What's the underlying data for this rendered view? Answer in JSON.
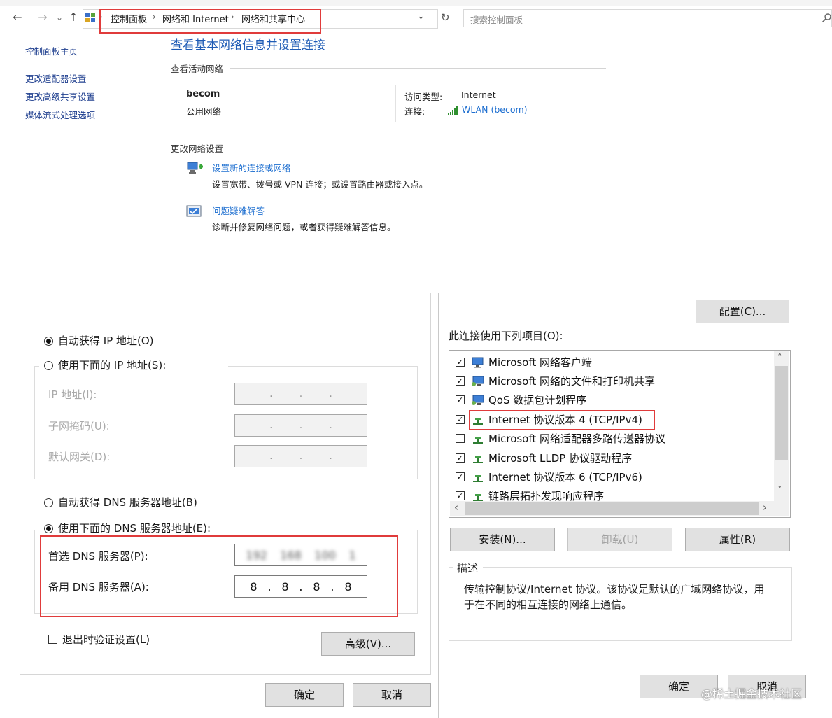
{
  "explorer": {
    "nav": {
      "back_icon": "←",
      "forward_icon": "→",
      "recent_icon": "⌄",
      "up_icon": "↑"
    },
    "breadcrumb": [
      "控制面板",
      "网络和 Internet",
      "网络和共享中心"
    ],
    "breadcrumb_sep": "›",
    "dropdown_icon": "⌄",
    "refresh_icon": "↻",
    "search_placeholder": "搜索控制面板"
  },
  "sidebar": {
    "home": "控制面板主页",
    "links": [
      "更改适配器设置",
      "更改高级共享设置",
      "媒体流式处理选项"
    ]
  },
  "main": {
    "title": "查看基本网络信息并设置连接",
    "active_networks_label": "查看活动网络",
    "network_name": "becom",
    "network_type": "公用网络",
    "access_type_label": "访问类型:",
    "access_type_value": "Internet",
    "connection_label": "连接:",
    "connection_value": "WLAN (becom)",
    "change_settings_label": "更改网络设置",
    "tasks": [
      {
        "title": "设置新的连接或网络",
        "desc": "设置宽带、拨号或 VPN 连接；或设置路由器或接入点。"
      },
      {
        "title": "问题疑难解答",
        "desc": "诊断并修复网络问题，或者获得疑难解答信息。"
      }
    ]
  },
  "ipv4_dialog": {
    "auto_ip": "自动获得 IP 地址(O)",
    "manual_ip": "使用下面的 IP 地址(S):",
    "ip_label": "IP 地址(I):",
    "mask_label": "子网掩码(U):",
    "gateway_label": "默认网关(D):",
    "ip_dot": ".",
    "auto_dns": "自动获得 DNS 服务器地址(B)",
    "manual_dns": "使用下面的 DNS 服务器地址(E):",
    "preferred_dns_label": "首选 DNS 服务器(P):",
    "preferred_dns_octets": [
      "192",
      "168",
      "100",
      "1"
    ],
    "alternate_dns_label": "备用 DNS 服务器(A):",
    "alternate_dns_octets": [
      "8",
      ".",
      "8",
      ".",
      "8",
      ".",
      "8"
    ],
    "validate_on_exit": "退出时验证设置(L)",
    "advanced_button": "高级(V)...",
    "ok_button": "确定",
    "cancel_button": "取消"
  },
  "adapter_dialog": {
    "configure_button": "配置(C)...",
    "items_label": "此连接使用下列项目(O):",
    "items": [
      {
        "label": "Microsoft 网络客户端",
        "checked": true,
        "icon": "client-icon"
      },
      {
        "label": "Microsoft 网络的文件和打印机共享",
        "checked": true,
        "icon": "sharing-icon"
      },
      {
        "label": "QoS 数据包计划程序",
        "checked": true,
        "icon": "qos-icon"
      },
      {
        "label": "Internet 协议版本 4 (TCP/IPv4)",
        "checked": true,
        "icon": "protocol-icon"
      },
      {
        "label": "Microsoft 网络适配器多路传送器协议",
        "checked": false,
        "icon": "protocol-icon"
      },
      {
        "label": "Microsoft LLDP 协议驱动程序",
        "checked": true,
        "icon": "protocol-icon"
      },
      {
        "label": "Internet 协议版本 6 (TCP/IPv6)",
        "checked": true,
        "icon": "protocol-icon"
      },
      {
        "label": "链路层拓扑发现响应程序",
        "checked": true,
        "icon": "protocol-icon"
      }
    ],
    "check_mark": "✓",
    "scroll_up": "˄",
    "scroll_down": "˅",
    "scroll_left": "‹",
    "scroll_right": "›",
    "install_button": "安装(N)...",
    "uninstall_button": "卸载(U)",
    "properties_button": "属性(R)",
    "description_label": "描述",
    "description_text_1": "传输控制协议/Internet 协议。该协议是默认的广域网络协议，用",
    "description_text_2": "于在不同的相互连接的网络上通信。",
    "ok_button": "确定",
    "cancel_button": "取消"
  },
  "watermark": "@稀土掘金技术社区",
  "colors": {
    "highlight_red": "#e03b3b",
    "link_blue": "#1e6fd0",
    "title_blue": "#1e5bb5"
  }
}
